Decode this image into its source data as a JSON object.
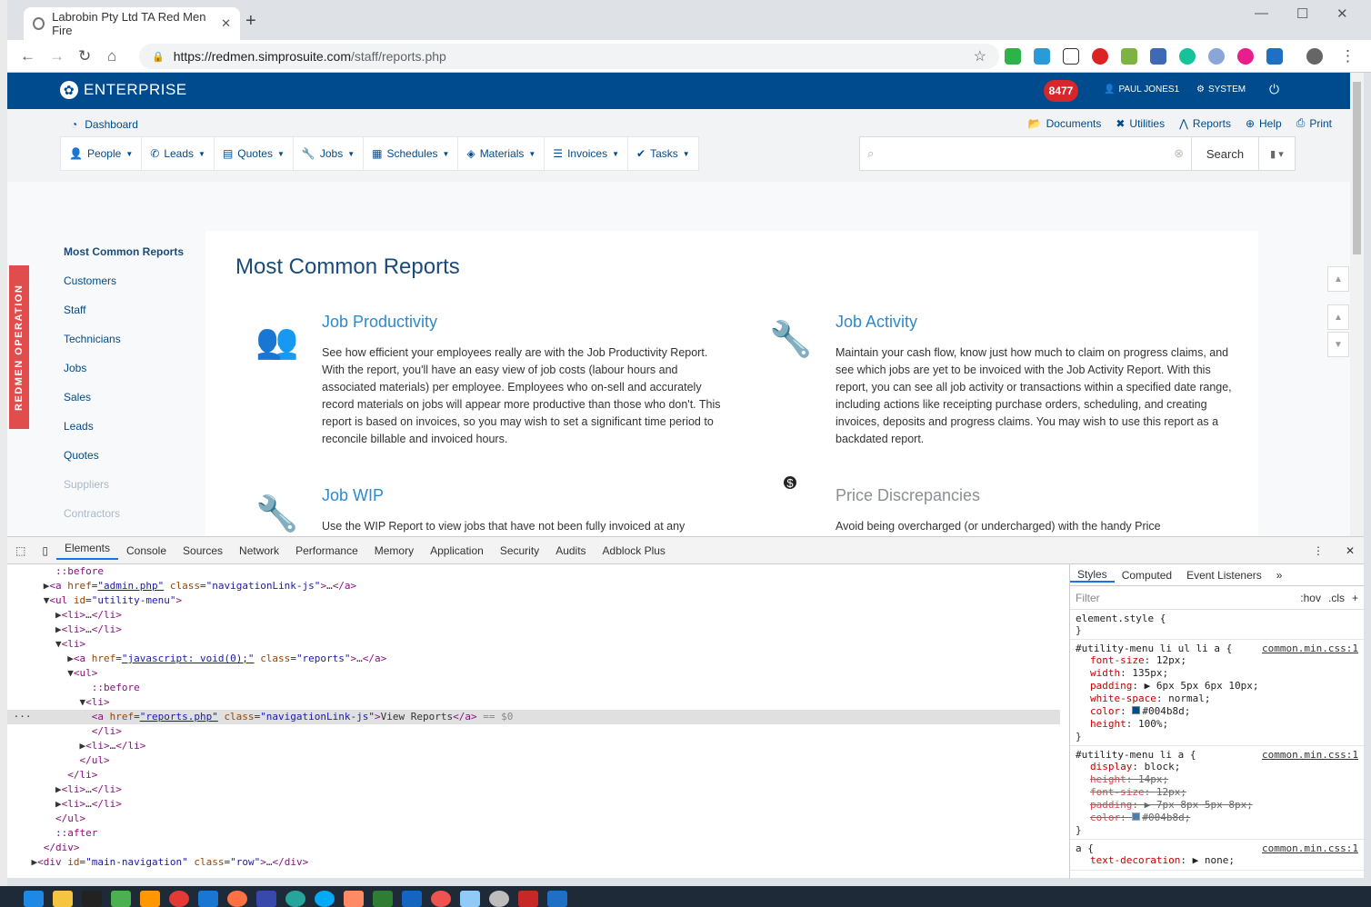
{
  "browser": {
    "tab_title": "Labrobin Pty Ltd TA Red Men Fire",
    "url_host": "https://redmen.simprosuite.com",
    "url_path": "/staff/reports.php"
  },
  "topbar": {
    "brand": "ENTERPRISE",
    "count": "8477",
    "user": "PAUL JONES1",
    "system": "SYSTEM"
  },
  "header": {
    "dashboard": "Dashboard",
    "utility": [
      "Documents",
      "Utilities",
      "Reports",
      "Help",
      "Print"
    ],
    "search_button": "Search"
  },
  "main_nav": [
    "People",
    "Leads",
    "Quotes",
    "Jobs",
    "Schedules",
    "Materials",
    "Invoices",
    "Tasks"
  ],
  "sidebar": {
    "items": [
      "Most Common Reports",
      "Customers",
      "Staff",
      "Technicians",
      "Jobs",
      "Sales",
      "Leads",
      "Quotes",
      "Suppliers",
      "Contractors"
    ]
  },
  "page": {
    "title": "Most Common Reports",
    "cards": [
      {
        "title": "Job Productivity",
        "desc": "See how efficient your employees really are with the Job Productivity Report. With the report, you'll have an easy view of job costs (labour hours and associated materials) per employee. Employees who on-sell and accurately record materials on jobs will appear more productive than those who don't. This report is based on invoices, so you may wish to set a significant time period to reconcile billable and invoiced hours."
      },
      {
        "title": "Job Activity",
        "desc": "Maintain your cash flow, know just how much to claim on progress claims, and see which jobs are yet to be invoiced with the Job Activity Report. With this report, you can see all job activity or transactions within a specified date range, including actions like receipting purchase orders, scheduling, and creating invoices, deposits and progress claims. You may wish to use this report as a backdated report."
      },
      {
        "title": "Job WIP",
        "desc": "Use the WIP Report to view jobs that have not been fully invoiced at any"
      },
      {
        "title": "Price Discrepancies",
        "desc": "Avoid being overcharged (or undercharged) with the handy Price"
      }
    ]
  },
  "side_tab": "REDMEN OPERATION",
  "devtools": {
    "tabs": [
      "Elements",
      "Console",
      "Sources",
      "Network",
      "Performance",
      "Memory",
      "Application",
      "Security",
      "Audits",
      "Adblock Plus"
    ],
    "style_tabs": [
      "Styles",
      "Computed",
      "Event Listeners"
    ],
    "filter_placeholder": "Filter",
    "hov": ":hov",
    "cls": ".cls"
  },
  "colors": {
    "brand_blue": "#004b8d",
    "badge_red": "#d9262c",
    "link_blue": "#2a8bd0",
    "side_tab": "#e14d4d"
  }
}
